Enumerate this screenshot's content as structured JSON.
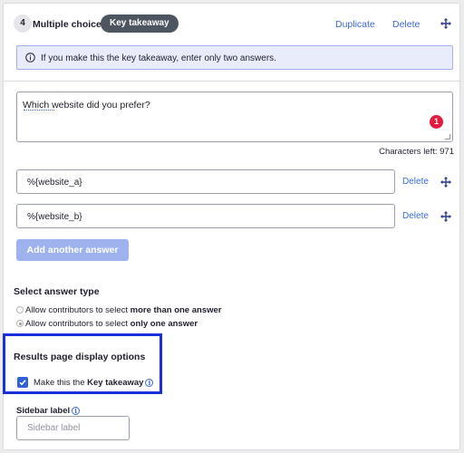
{
  "header": {
    "question_number": "4",
    "question_type": "Multiple choice",
    "badge": "Key takeaway",
    "duplicate_label": "Duplicate",
    "delete_label": "Delete"
  },
  "info_banner": {
    "icon": "info-icon",
    "text": "If you make this the key takeaway, enter only two answers."
  },
  "question": {
    "text": "Which website did you prefer?",
    "error_count": "1",
    "chars_left_label": "Characters left: 971"
  },
  "answers": [
    {
      "value": "%{website_a}",
      "delete_label": "Delete"
    },
    {
      "value": "%{website_b}",
      "delete_label": "Delete"
    }
  ],
  "add_answer_label": "Add another answer",
  "answer_type": {
    "heading": "Select answer type",
    "options": [
      {
        "prefix": "Allow contributors to select ",
        "bold": "more than one answer",
        "selected": false
      },
      {
        "prefix": "Allow contributors to select ",
        "bold": "only one answer",
        "selected": true
      }
    ]
  },
  "results_display": {
    "heading": "Results page display options",
    "checkbox_prefix": "Make this the ",
    "checkbox_bold": "Key takeaway",
    "checked": true
  },
  "sidebar": {
    "label": "Sidebar label",
    "placeholder": "Sidebar label"
  },
  "colors": {
    "accent": "#3d6ad6",
    "badge_bg": "#4d5660",
    "error": "#e21c3f",
    "highlight_border": "#1a2fdc",
    "button_disabled": "#9eb2ee"
  }
}
